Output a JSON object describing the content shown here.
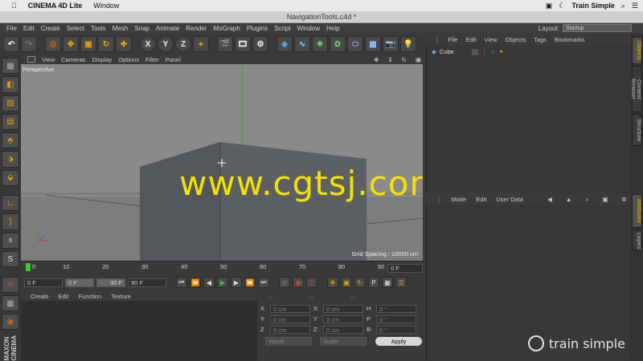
{
  "mac_menu": {
    "apple": "",
    "app": "CINEMA 4D Lite",
    "window": "Window",
    "brand": "Train Simple"
  },
  "window_title": "NavigationTools.c4d *",
  "main_menu": [
    "File",
    "Edit",
    "Create",
    "Select",
    "Tools",
    "Mesh",
    "Snap",
    "Animate",
    "Render",
    "MoGraph",
    "Plugins",
    "Script",
    "Window",
    "Help"
  ],
  "layout": {
    "label": "Layout:",
    "value": "Startup"
  },
  "toolbar": {
    "x": "X",
    "y": "Y",
    "z": "Z"
  },
  "viewport": {
    "menu": [
      "View",
      "Cameras",
      "Display",
      "Options",
      "Filter",
      "Panel"
    ],
    "label": "Perspective",
    "grid_spacing": "Grid Spacing : 10000 cm",
    "watermark": "www.cgtsj.com"
  },
  "timeline": {
    "ticks": [
      "0",
      "10",
      "20",
      "30",
      "40",
      "50",
      "60",
      "70",
      "80",
      "90"
    ],
    "current_frame": "0 F"
  },
  "transport": {
    "start": "0 F",
    "range_start": "0 F",
    "range_end": "90 F",
    "end": "90 F"
  },
  "material_menu": [
    "Create",
    "Edit",
    "Function",
    "Texture"
  ],
  "coords": {
    "headers": [
      "--",
      "--",
      "--"
    ],
    "rows": [
      {
        "a1": "X",
        "v1": "0 cm",
        "a2": "X",
        "v2": "0 cm",
        "a3": "H",
        "v3": "0 °"
      },
      {
        "a1": "Y",
        "v1": "0 cm",
        "a2": "Y",
        "v2": "0 cm",
        "a3": "P",
        "v3": "0 °"
      },
      {
        "a1": "Z",
        "v1": "0 cm",
        "a2": "Z",
        "v2": "0 cm",
        "a3": "B",
        "v3": "0 °"
      }
    ],
    "world": "World",
    "scale": "Scale",
    "apply": "Apply"
  },
  "objects_menu": [
    "File",
    "Edit",
    "View",
    "Objects",
    "Tags",
    "Bookmarks"
  ],
  "objects": [
    {
      "name": "Cube"
    }
  ],
  "attributes_menu": [
    "Mode",
    "Edit",
    "User Data"
  ],
  "right_tabs": {
    "objects": "Objects",
    "content_browser": "Content Browser",
    "structure": "Structure",
    "attributes": "Attributes",
    "layers": "Layers"
  },
  "left_logo": {
    "top": "MAXON",
    "bottom": "CINEMA"
  },
  "corner_logo": "train simple",
  "colors": {
    "accent": "#f0b000",
    "watermark": "#f5e200",
    "viewport_bg": "#8b8b8b"
  }
}
